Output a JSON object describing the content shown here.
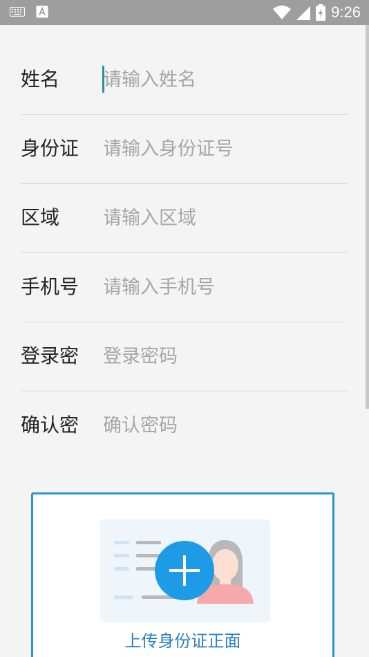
{
  "status_bar": {
    "time": "9:26",
    "icons": [
      "keyboard-icon",
      "a-notification-icon",
      "wifi-icon",
      "signal-icon",
      "battery-charging-icon"
    ],
    "bg_color": "#9e9e9e"
  },
  "form": {
    "fields": [
      {
        "label": "姓名",
        "placeholder": "请输入姓名",
        "value": ""
      },
      {
        "label": "身份证",
        "placeholder": "请输入身份证号",
        "value": ""
      },
      {
        "label": "区域",
        "placeholder": "请输入区域",
        "value": ""
      },
      {
        "label": "手机号",
        "placeholder": "请输入手机号",
        "value": ""
      },
      {
        "label": "登录密",
        "placeholder": "登录密码",
        "value": ""
      },
      {
        "label": "确认密",
        "placeholder": "确认密码",
        "value": ""
      }
    ]
  },
  "upload": {
    "front_label": "上传身份证正面",
    "icon": "add-circle-icon",
    "accent_color": "#2596d6"
  }
}
